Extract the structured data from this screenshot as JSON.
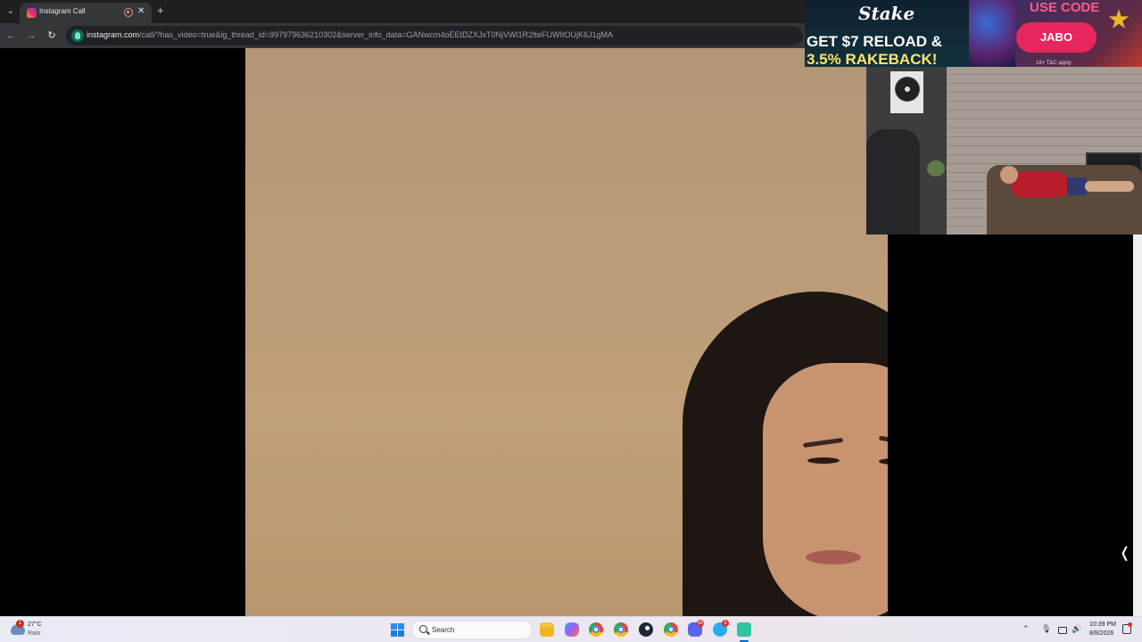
{
  "browser": {
    "tab_title": "Instagram Call",
    "new_tab_label": "+",
    "close_label": "✕",
    "url_host": "instagram.com",
    "url_path": "/call/?has_video=true&ig_thread_id=997979636210302&server_info_data=GANwcm4oEEtDZXJxT0NjVWl1R2tteFUWItOUjK6J1gMA"
  },
  "ad": {
    "brand": "Stake",
    "headline_line1": "GET $7 RELOAD &",
    "headline_line2": "3.5% RAKEBACK!",
    "use_code": "USE CODE",
    "code": "JABO",
    "terms": "18+  T&C apply",
    "colors": {
      "button": "#e8265e",
      "headline_accent": "#ffe66a"
    }
  },
  "taskbar": {
    "weather": {
      "temp": "27°C",
      "condition": "Rain",
      "badge": "1"
    },
    "search_placeholder": "Search",
    "apps": [
      {
        "name": "file-explorer",
        "icon": "folder-icon"
      },
      {
        "name": "copilot",
        "icon": "copilot-icon"
      },
      {
        "name": "chrome",
        "icon": "chrome-icon"
      },
      {
        "name": "chrome-profile-2",
        "icon": "chrome-icon"
      },
      {
        "name": "steam",
        "icon": "steam-icon"
      },
      {
        "name": "chrome-profile-3",
        "icon": "chrome-icon"
      },
      {
        "name": "discord",
        "icon": "discord-icon",
        "badge": "99"
      },
      {
        "name": "telegram",
        "icon": "telegram-icon",
        "badge": "5"
      },
      {
        "name": "streamlabs",
        "icon": "streamlabs-icon"
      }
    ],
    "clock_time": "10:39 PM",
    "clock_date": "8/8/2026",
    "tray_icons": [
      "chevron-up-icon",
      "microphone-icon",
      "network-icon",
      "volume-icon"
    ]
  },
  "call": {
    "pip_toggle_icon": "chevron-left-icon",
    "scroll_icon": "scroll-down-icon"
  }
}
